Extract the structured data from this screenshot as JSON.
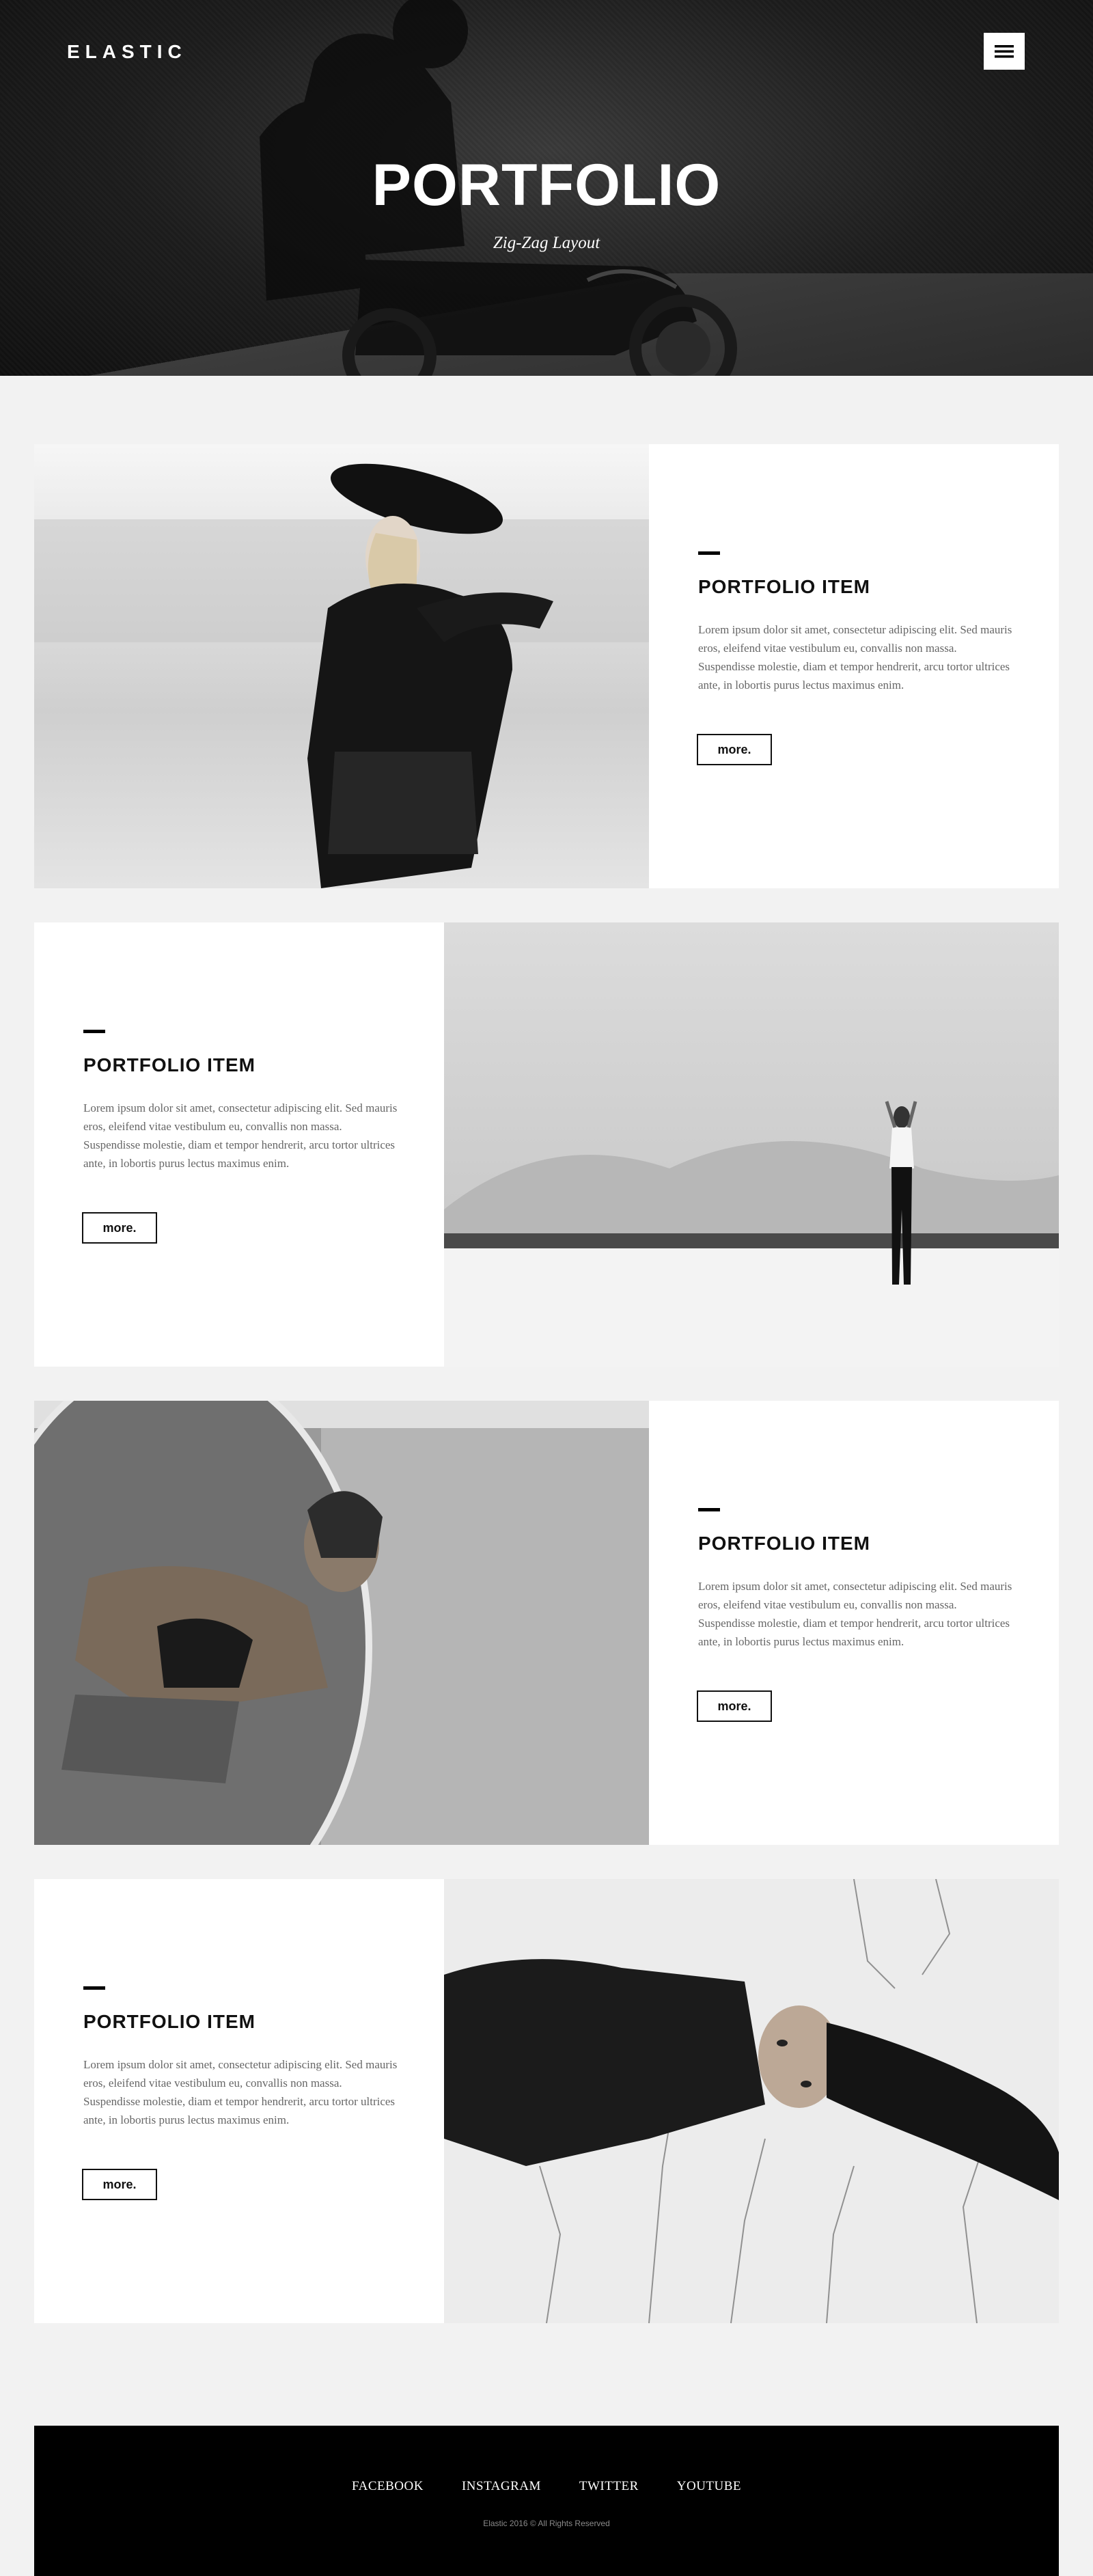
{
  "header": {
    "logo": "ELASTIC",
    "menu_icon": "hamburger-menu-icon",
    "title": "PORTFOLIO",
    "subtitle": "Zig-Zag Layout"
  },
  "portfolio": {
    "items": [
      {
        "title": "PORTFOLIO ITEM",
        "description": "Lorem ipsum dolor sit amet, consectetur adipiscing elit. Sed mauris eros, eleifend vitae vestibulum eu, convallis non massa. Suspendisse molestie, diam et tempor hendrerit, arcu tortor ultrices ante, in lobortis purus lectus maximus enim.",
        "button": "more."
      },
      {
        "title": "PORTFOLIO ITEM",
        "description": "Lorem ipsum dolor sit amet, consectetur adipiscing elit. Sed mauris eros, eleifend vitae vestibulum eu, convallis non massa. Suspendisse molestie, diam et tempor hendrerit, arcu tortor ultrices ante, in lobortis purus lectus maximus enim.",
        "button": "more."
      },
      {
        "title": "PORTFOLIO ITEM",
        "description": "Lorem ipsum dolor sit amet, consectetur adipiscing elit. Sed mauris eros, eleifend vitae vestibulum eu, convallis non massa. Suspendisse molestie, diam et tempor hendrerit, arcu tortor ultrices ante, in lobortis purus lectus maximus enim.",
        "button": "more."
      },
      {
        "title": "PORTFOLIO ITEM",
        "description": "Lorem ipsum dolor sit amet, consectetur adipiscing elit. Sed mauris eros, eleifend vitae vestibulum eu, convallis non massa. Suspendisse molestie, diam et tempor hendrerit, arcu tortor ultrices ante, in lobortis purus lectus maximus enim.",
        "button": "more."
      }
    ]
  },
  "footer": {
    "links": [
      "FACEBOOK",
      "INSTAGRAM",
      "TWITTER",
      "YOUTUBE"
    ],
    "copyright": "Elastic 2016 © All Rights Reserved"
  },
  "colors": {
    "page_background": "#f2f2f2",
    "card_background": "#ffffff",
    "footer_background": "#000000",
    "text_dark": "#111111",
    "text_muted": "#666666"
  }
}
